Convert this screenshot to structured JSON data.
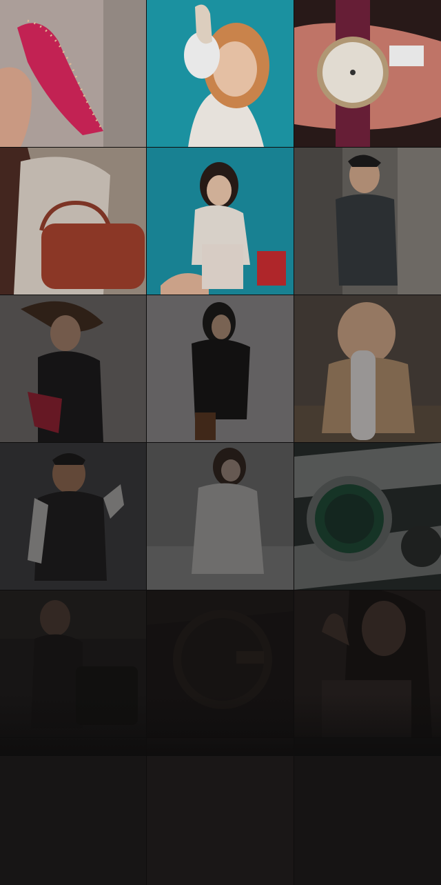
{
  "gallery": {
    "tiles": [
      {
        "icon": "pink-studded-flat-shoe",
        "bg": "#b8a9a3"
      },
      {
        "icon": "woman-holding-shoe",
        "bg": "#1b97a6"
      },
      {
        "icon": "luxury-watch-in-hand",
        "bg": "#3a2422"
      },
      {
        "icon": "woman-with-red-handbag",
        "bg": "#9d8f86"
      },
      {
        "icon": "woman-with-handbags-teal",
        "bg": "#1c8ea0"
      },
      {
        "icon": "man-in-striped-tshirt",
        "bg": "#706b66"
      },
      {
        "icon": "woman-in-black-dress",
        "bg": "#7a7574"
      },
      {
        "icon": "woman-in-leather-jacket",
        "bg": "#8d8b8c"
      },
      {
        "icon": "baby-with-bottle",
        "bg": "#4b443d"
      },
      {
        "icon": "man-in-varsity-jacket",
        "bg": "#4f4f52"
      },
      {
        "icon": "woman-in-white",
        "bg": "#8d8f8e"
      },
      {
        "icon": "green-dial-watch",
        "bg": "#2b3533"
      },
      {
        "icon": "woman-with-tote-bag",
        "bg": "#2a2726"
      },
      {
        "icon": "gold-watch-closeup",
        "bg": "#262220"
      },
      {
        "icon": "woman-peace-sign",
        "bg": "#3a3230"
      }
    ],
    "dim_levels": [
      0.08,
      0.05,
      0.05,
      0.12,
      0.1,
      0.2,
      0.45,
      0.45,
      0.4,
      0.55,
      0.55,
      0.5,
      0.7,
      0.72,
      0.7
    ]
  }
}
